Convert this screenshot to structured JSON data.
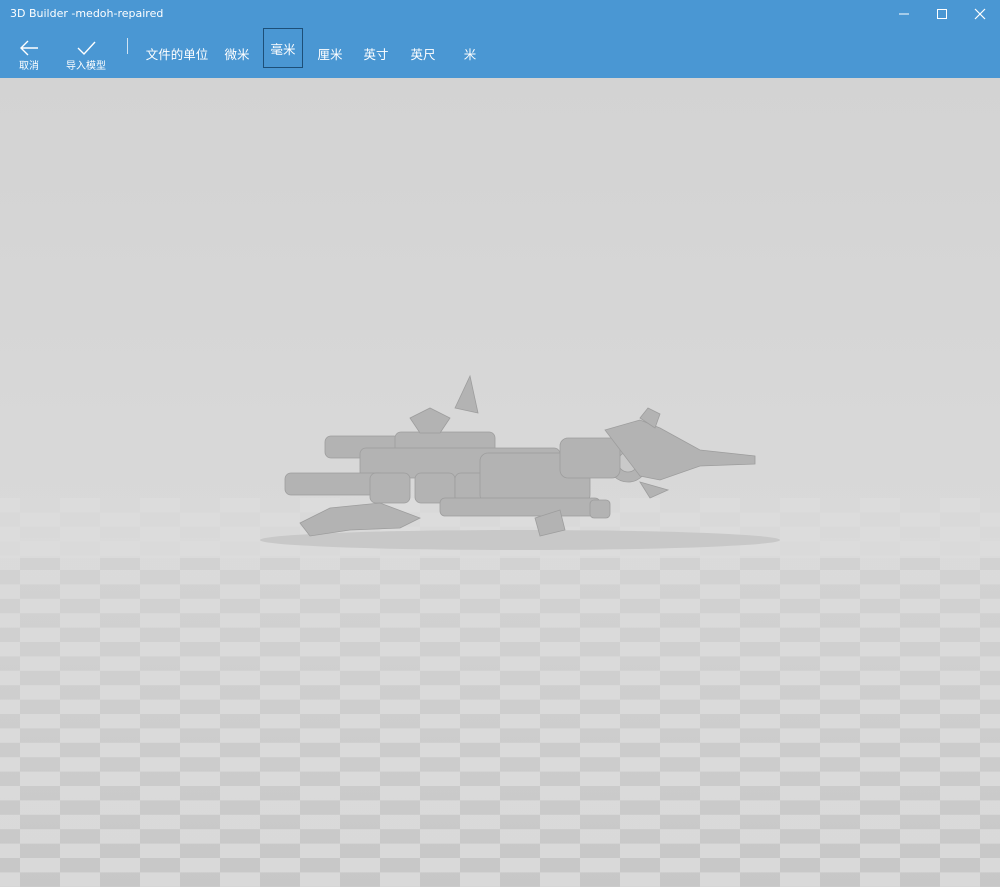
{
  "window": {
    "title": "3D Builder -medoh-repaired",
    "controls": [
      "minimize-icon",
      "maximize-icon",
      "close-icon"
    ]
  },
  "toolbar": {
    "cancel_label": "取消",
    "cancel_icon": "back-arrow-icon",
    "import_label": "导入模型",
    "import_icon": "checkmark-icon",
    "file_unit_label": "文件的单位",
    "units": [
      {
        "label": "微米",
        "selected": false
      },
      {
        "label": "毫米",
        "selected": true
      },
      {
        "label": "厘米",
        "selected": false
      },
      {
        "label": "英寸",
        "selected": false
      },
      {
        "label": "英尺",
        "selected": false
      },
      {
        "label": "米",
        "selected": false
      }
    ]
  },
  "colors": {
    "accent": "#4a97d3",
    "selected_border": "#1d4f78",
    "floor_light": "#d8d8d8",
    "floor_dark": "#c6c6c6",
    "fog": "#dcdcdc",
    "model": "#b4b4b4"
  }
}
